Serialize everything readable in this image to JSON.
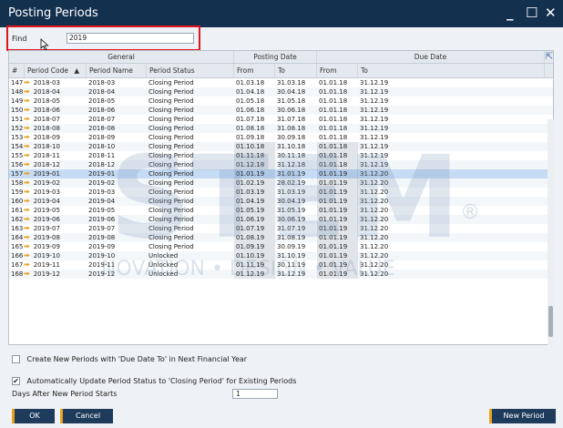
{
  "window": {
    "title": "Posting Periods",
    "minimize": "_",
    "maximize": "☐",
    "close": "✕"
  },
  "find": {
    "label": "Find",
    "value": "2019"
  },
  "grid": {
    "groups": {
      "general": "General",
      "posting": "Posting Date",
      "due": "Due Date"
    },
    "columns": {
      "num": "#",
      "code": "Period Code",
      "name": "Period Name",
      "status": "Period Status",
      "pfrom": "From",
      "pto": "To",
      "dfrom": "From",
      "dto": "To"
    },
    "rows": [
      [
        "147",
        "2018-03",
        "2018-03",
        "Closing Period",
        "01.03.18",
        "31.03.18",
        "01.01.18",
        "31.12.19"
      ],
      [
        "148",
        "2018-04",
        "2018-04",
        "Closing Period",
        "01.04.18",
        "30.04.18",
        "01.01.18",
        "31.12.19"
      ],
      [
        "149",
        "2018-05",
        "2018-05",
        "Closing Period",
        "01.05.18",
        "31.05.18",
        "01.01.18",
        "31.12.19"
      ],
      [
        "150",
        "2018-06",
        "2018-06",
        "Closing Period",
        "01.06.18",
        "30.06.18",
        "01.01.18",
        "31.12.19"
      ],
      [
        "151",
        "2018-07",
        "2018-07",
        "Closing Period",
        "01.07.18",
        "31.07.18",
        "01.01.18",
        "31.12.19"
      ],
      [
        "152",
        "2018-08",
        "2018-08",
        "Closing Period",
        "01.08.18",
        "31.08.18",
        "01.01.18",
        "31.12.19"
      ],
      [
        "153",
        "2018-09",
        "2018-09",
        "Closing Period",
        "01.09.18",
        "30.09.18",
        "01.01.18",
        "31.12.19"
      ],
      [
        "154",
        "2018-10",
        "2018-10",
        "Closing Period",
        "01.10.18",
        "31.10.18",
        "01.01.18",
        "31.12.19"
      ],
      [
        "155",
        "2018-11",
        "2018-11",
        "Closing Period",
        "01.11.18",
        "30.11.18",
        "01.01.18",
        "31.12.19"
      ],
      [
        "156",
        "2018-12",
        "2018-12",
        "Closing Period",
        "01.12.18",
        "31.12.18",
        "01.01.18",
        "31.12.19"
      ],
      [
        "157",
        "2019-01",
        "2019-01",
        "Closing Period",
        "01.01.19",
        "31.01.19",
        "01.01.19",
        "31.12.20"
      ],
      [
        "158",
        "2019-02",
        "2019-02",
        "Closing Period",
        "01.02.19",
        "28.02.19",
        "01.01.19",
        "31.12.20"
      ],
      [
        "159",
        "2019-03",
        "2019-03",
        "Closing Period",
        "01.03.19",
        "31.03.19",
        "01.01.19",
        "31.12.20"
      ],
      [
        "160",
        "2019-04",
        "2019-04",
        "Closing Period",
        "01.04.19",
        "30.04.19",
        "01.01.19",
        "31.12.20"
      ],
      [
        "161",
        "2019-05",
        "2019-05",
        "Closing Period",
        "01.05.19",
        "31.05.19",
        "01.01.19",
        "31.12.20"
      ],
      [
        "162",
        "2019-06",
        "2019-06",
        "Closing Period",
        "01.06.19",
        "30.06.19",
        "01.01.19",
        "31.12.20"
      ],
      [
        "163",
        "2019-07",
        "2019-07",
        "Closing Period",
        "01.07.19",
        "31.07.19",
        "01.01.19",
        "31.12.20"
      ],
      [
        "164",
        "2019-08",
        "2019-08",
        "Closing Period",
        "01.08.19",
        "31.08.19",
        "01.01.19",
        "31.12.20"
      ],
      [
        "165",
        "2019-09",
        "2019-09",
        "Closing Period",
        "01.09.19",
        "30.09.19",
        "01.01.19",
        "31.12.20"
      ],
      [
        "166",
        "2019-10",
        "2019-10",
        "Unlocked",
        "01.10.19",
        "31.10.19",
        "01.01.19",
        "31.12.20"
      ],
      [
        "167",
        "2019-11",
        "2019-11",
        "Unlocked",
        "01.11.19",
        "30.11.19",
        "01.01.19",
        "31.12.20"
      ],
      [
        "168",
        "2019-12",
        "2019-12",
        "Unlocked",
        "01.12.19",
        "31.12.19",
        "01.01.19",
        "31.12.20"
      ]
    ],
    "selected_row": "157"
  },
  "options": {
    "create_new": {
      "label": "Create New Periods with 'Due Date To' in Next Financial Year",
      "checked": false
    },
    "auto_update": {
      "label": "Automatically Update Period Status to 'Closing Period' for Existing Periods",
      "checked": true,
      "mark": "✔"
    },
    "days_label": "Days After New Period Starts",
    "days_value": "1"
  },
  "buttons": {
    "ok": "OK",
    "cancel": "Cancel",
    "new_period": "New Period"
  },
  "watermark": {
    "brand": "STEM",
    "tagline": "INNOVATION • DESIGN • VALUE",
    "registered": "®"
  },
  "colors": {
    "titlebar": "#14304f",
    "accent": "#e8a21c",
    "highlight": "#e0141e",
    "selected": "#c6dcf4"
  }
}
